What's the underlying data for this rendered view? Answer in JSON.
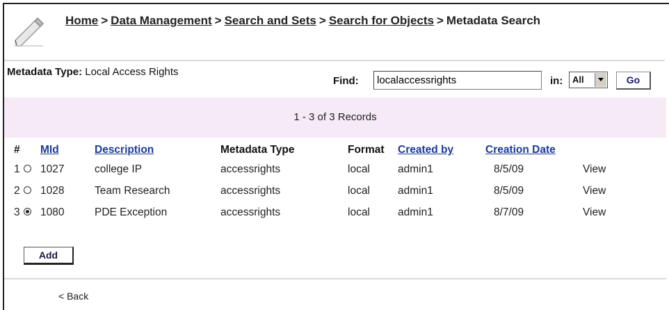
{
  "breadcrumb": {
    "items": [
      "Home",
      "Data Management",
      "Search and Sets",
      "Search for Objects"
    ],
    "current": "Metadata Search",
    "separator": ">"
  },
  "metadata_type": {
    "label": "Metadata Type:",
    "value": "Local Access Rights"
  },
  "find": {
    "label": "Find:",
    "value": "localaccessrights",
    "in_label": "in:",
    "in_selected": "All",
    "go_label": "Go"
  },
  "records_text": "1 - 3 of 3 Records",
  "table": {
    "columns": [
      "#",
      "MId",
      "Description",
      "Metadata Type",
      "Format",
      "Created by",
      "Creation Date"
    ],
    "rows": [
      {
        "num": "1",
        "mid": "1027",
        "description": "college IP",
        "type": "accessrights",
        "format": "local",
        "created_by": "admin1",
        "date": "8/5/09",
        "action": "View",
        "selected": false
      },
      {
        "num": "2",
        "mid": "1028",
        "description": "Team Research",
        "type": "accessrights",
        "format": "local",
        "created_by": "admin1",
        "date": "8/5/09",
        "action": "View",
        "selected": false
      },
      {
        "num": "3",
        "mid": "1080",
        "description": "PDE Exception",
        "type": "accessrights",
        "format": "local",
        "created_by": "admin1",
        "date": "8/7/09",
        "action": "View",
        "selected": true
      }
    ]
  },
  "add_label": "Add",
  "back_label": "< Back",
  "colors": {
    "link": "#1a3a99",
    "band": "#f5eaf5",
    "divider": "#d9d9d9"
  },
  "icons": {
    "header": "pencil-icon"
  }
}
